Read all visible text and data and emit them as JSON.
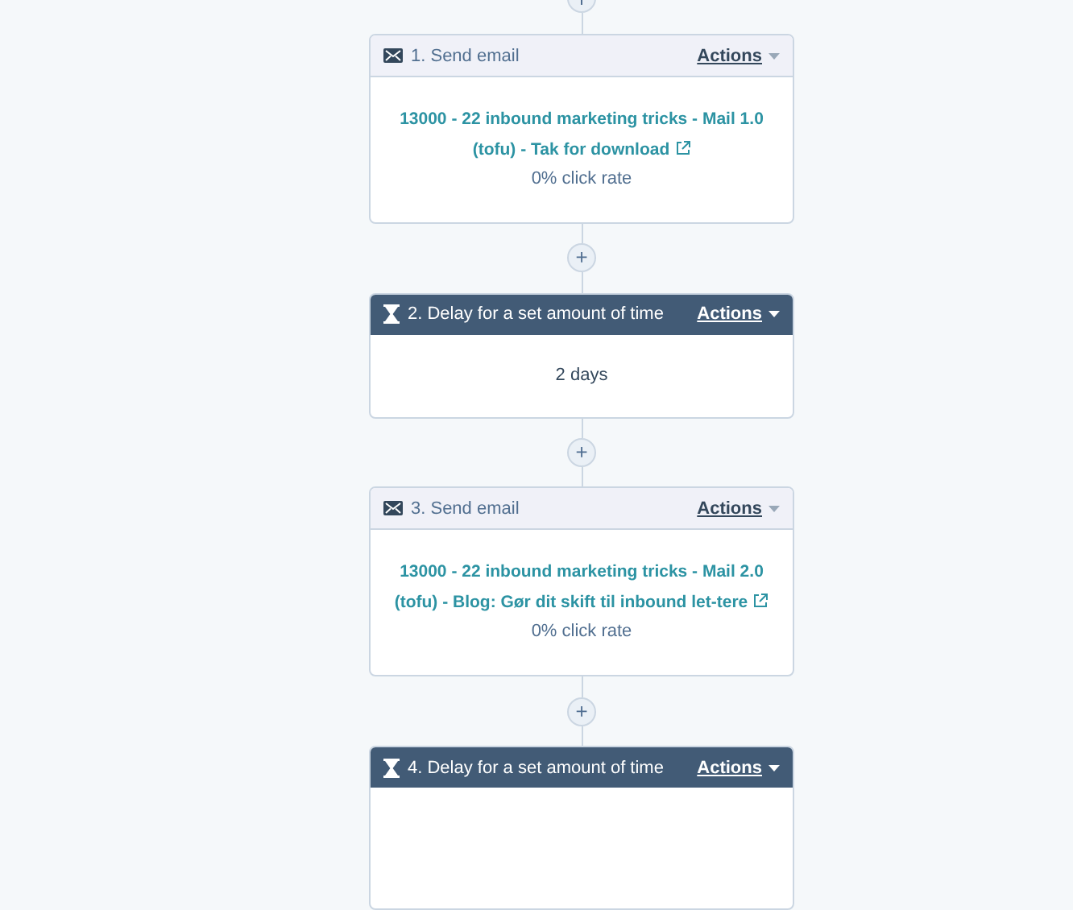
{
  "add_buttons": [
    {
      "label": "+"
    },
    {
      "label": "+"
    },
    {
      "label": "+"
    }
  ],
  "steps": [
    {
      "kind": "email",
      "title": "1. Send email",
      "actions": "Actions",
      "link": "13000 - 22 inbound marketing tricks - Mail 1.0 (tofu) - Tak for download",
      "stat": "0% click rate"
    },
    {
      "kind": "delay",
      "title": "2. Delay for a set amount of time",
      "actions": "Actions",
      "text": "2 days"
    },
    {
      "kind": "email",
      "title": "3. Send email",
      "actions": "Actions",
      "link": "13000 - 22 inbound marketing tricks - Mail 2.0 (tofu) - Blog: Gør dit skift til inbound let-tere",
      "stat": "0% click rate"
    },
    {
      "kind": "delay",
      "title": "4. Delay for a set amount of time",
      "actions": "Actions"
    }
  ]
}
